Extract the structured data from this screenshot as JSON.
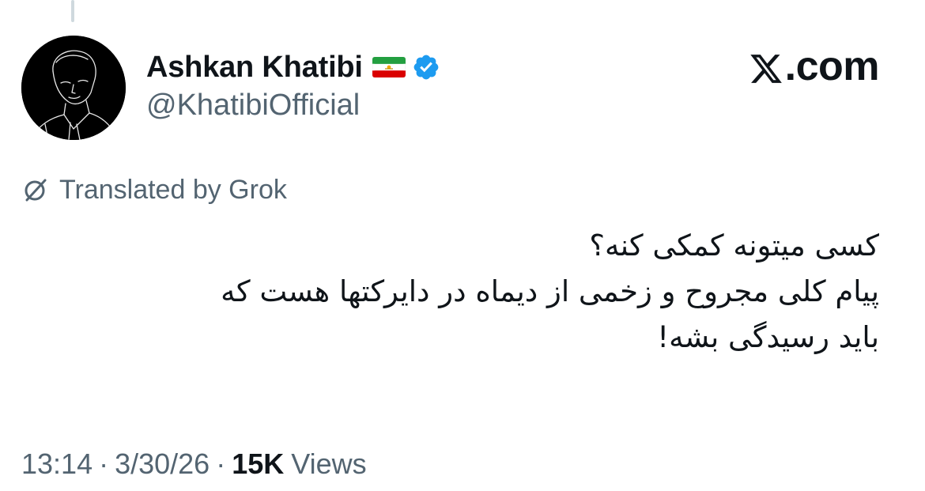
{
  "author": {
    "display_name": "Ashkan Khatibi",
    "handle": "@KhatibiOfficial",
    "flag_icon": "iran-lion-and-sun-flag-icon",
    "verified_icon": "verified-badge-icon",
    "verified_color": "#1d9bf0"
  },
  "brand": {
    "logo_icon": "x-logo-icon",
    "label": ".com"
  },
  "translation": {
    "icon": "translate-icon",
    "label": "Translated by Grok"
  },
  "tweet": {
    "lines": [
      "کسی میتونه کمکی کنه؟",
      "پیام کلی مجروح و زخمی از دیماه در دایرکتها هست که",
      "باید رسیدگی بشه!"
    ]
  },
  "meta": {
    "time": "13:14",
    "date": "3/30/26",
    "separator": "·",
    "views_count": "15K",
    "views_label": "Views"
  },
  "colors": {
    "text_primary": "#0f1419",
    "text_secondary": "#536471",
    "thread_line": "#cfd9de"
  }
}
